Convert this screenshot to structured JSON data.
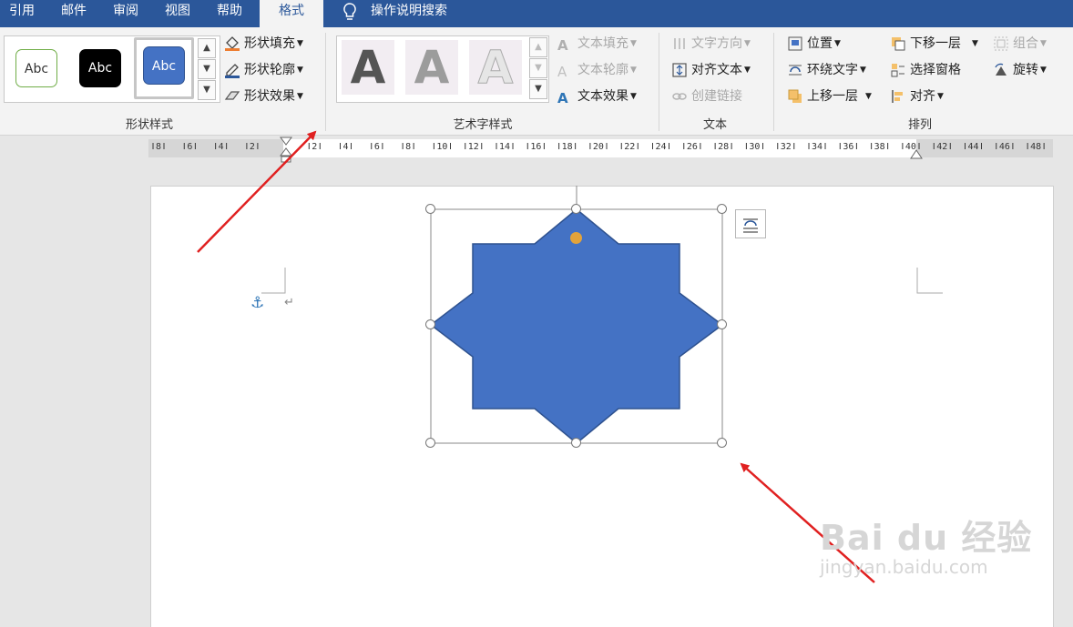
{
  "tabs": [
    {
      "label": "引用"
    },
    {
      "label": "邮件"
    },
    {
      "label": "审阅"
    },
    {
      "label": "视图"
    },
    {
      "label": "帮助"
    },
    {
      "label": "格式"
    }
  ],
  "tell_me": "操作说明搜索",
  "shape_styles": {
    "presets": [
      "Abc",
      "Abc",
      "Abc"
    ],
    "fill": "形状填充",
    "outline": "形状轮廓",
    "effects": "形状效果",
    "label": "形状样式"
  },
  "wordart": {
    "samples": [
      "A",
      "A",
      "A"
    ],
    "text_fill": "文本填充",
    "text_outline": "文本轮廓",
    "text_effects": "文本效果",
    "label": "艺术字样式"
  },
  "text_group": {
    "direction": "文字方向",
    "align_text": "对齐文本",
    "create_link": "创建链接",
    "label": "文本"
  },
  "arrange": {
    "position": "位置",
    "wrap_text": "环绕文字",
    "bring_forward": "上移一层",
    "send_backward": "下移一层",
    "selection_pane": "选择窗格",
    "align": "对齐",
    "group": "组合",
    "rotate": "旋转",
    "label": "排列"
  },
  "ruler_labels": [
    "8",
    "6",
    "4",
    "2",
    "2",
    "4",
    "6",
    "8",
    "10",
    "12",
    "14",
    "16",
    "18",
    "20",
    "22",
    "24",
    "26",
    "28",
    "30",
    "32",
    "34",
    "36",
    "38",
    "40",
    "42",
    "44",
    "46",
    "48"
  ],
  "colors": {
    "accent": "#2b579a",
    "shape_fill": "#4472c4",
    "shape_stroke": "#2f528f",
    "adjust_handle": "#e3a33b",
    "arrow": "#e02020"
  },
  "watermark": {
    "brand": "Bai du 经验",
    "url": "jingyan.baidu.com"
  }
}
